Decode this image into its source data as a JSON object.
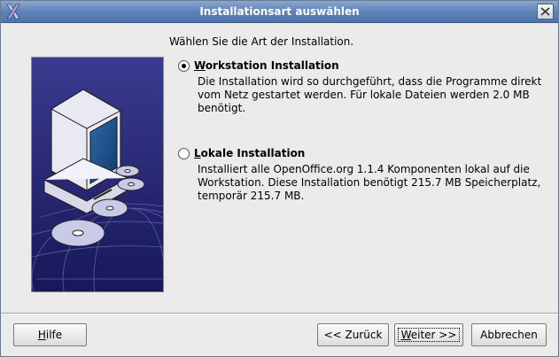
{
  "window": {
    "title": "Installationsart auswählen",
    "app_icon": "x-logo-icon",
    "close_icon": "close-icon"
  },
  "prompt": "Wählen Sie die Art der Installation.",
  "options": [
    {
      "label_mnemonic": "W",
      "label_rest": "orkstation Installation",
      "description": "Die Installation wird so durchgeführt, dass die Programme direkt vom Netz gestartet werden. Für lokale Dateien werden 2.0 MB benötigt.",
      "selected": true
    },
    {
      "label_mnemonic": "L",
      "label_rest": "okale Installation",
      "description": "Installiert alle OpenOffice.org 1.1.4 Komponenten lokal auf die Workstation. Diese Installation benötigt 215.7 MB Speicherplatz, temporär 215.7 MB.",
      "selected": false
    }
  ],
  "buttons": {
    "help_mnemonic": "H",
    "help_rest": "ilfe",
    "back": "<< Zurück",
    "next_mnemonic": "W",
    "next_rest": "eiter >>",
    "cancel": "Abbrechen"
  },
  "colors": {
    "titlebar": "#5f83b8",
    "banner_bg": "#1f1f6b",
    "monitor_screen": "#1c4f8a"
  }
}
